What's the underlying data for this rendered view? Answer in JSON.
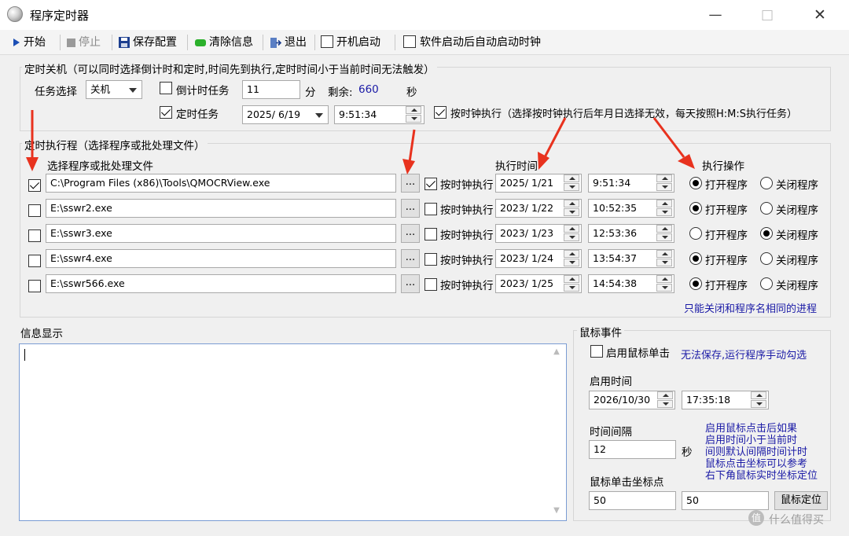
{
  "window": {
    "title": "程序定时器"
  },
  "toolbar": {
    "start": "开始",
    "stop": "停止",
    "save": "保存配置",
    "clear": "清除信息",
    "exit": "退出",
    "boot_start": "开机启动",
    "auto_clock": "软件启动后自动启动时钟"
  },
  "shutdown_group": {
    "legend": "定时关机（可以同时选择倒计时和定时,时间先到执行,定时时间小于当前时间无法触发）",
    "task_label": "任务选择",
    "task_value": "关机",
    "countdown_label": "倒计时任务",
    "countdown_value": "11",
    "minute_unit": "分",
    "remaining_label": "剩余:",
    "remaining_value": "660",
    "second_unit": "秒",
    "timed_label": "定时任务",
    "date_value": "2025/ 6/19",
    "time_value": "9:51:34",
    "by_clock_label": "按时钟执行（选择按时钟执行后年月日选择无效，每天按照H:M:S执行任务）"
  },
  "program_group": {
    "legend": "定时执行程（选择程序或批处理文件）",
    "select_header": "选择程序或批处理文件",
    "time_header": "执行时间",
    "op_header": "执行操作",
    "browse_label": "...",
    "by_clock_label": "按时钟执行",
    "open_label": "打开程序",
    "close_label": "关闭程序",
    "rows": [
      {
        "path": "C:\\Program Files (x86)\\Tools\\QMOCRView.exe",
        "date": "2025/ 1/21",
        "time": "9:51:34"
      },
      {
        "path": "E:\\sswr2.exe",
        "date": "2023/ 1/22",
        "time": "10:52:35"
      },
      {
        "path": "E:\\sswr3.exe",
        "date": "2023/ 1/23",
        "time": "12:53:36"
      },
      {
        "path": "E:\\sswr4.exe",
        "date": "2023/ 1/24",
        "time": "13:54:37"
      },
      {
        "path": "E:\\sswr566.exe",
        "date": "2023/ 1/25",
        "time": "14:54:38"
      }
    ],
    "note": "只能关闭和程序名相同的进程"
  },
  "info": {
    "label": "信息显示"
  },
  "mouse": {
    "legend": "鼠标事件",
    "enable_label": "启用鼠标单击",
    "note": "无法保存,运行程序手动勾选",
    "start_time_label": "启用时间",
    "start_date": "2026/10/30",
    "start_time": "17:35:18",
    "interval_label": "时间间隔",
    "interval_value": "12",
    "interval_unit": "秒",
    "hint1": "启用鼠标点击后如果",
    "hint2": "启用时间小于当前时",
    "hint3": "间则默认间隔时间计时",
    "hint4": "鼠标点击坐标可以参考",
    "hint5": "右下角鼠标实时坐标定位",
    "coord_label": "鼠标单击坐标点",
    "x_value": "50",
    "y_value": "50",
    "locate_button": "鼠标定位"
  },
  "watermark": "什么值得买",
  "colors": {
    "accent_arrow": "#e8321e",
    "link_blue": "#1a1aa6",
    "counter_blue": "#1a1aa6"
  }
}
